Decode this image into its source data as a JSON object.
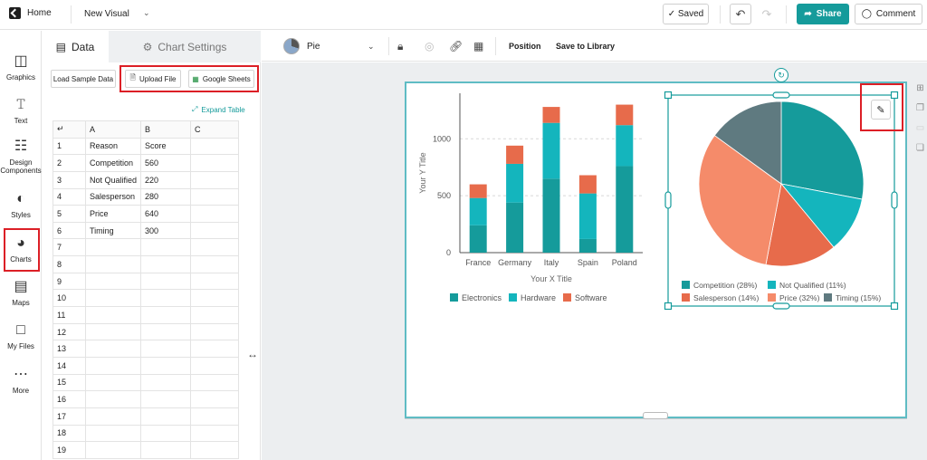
{
  "topbar": {
    "home_label": "Home",
    "project_name": "New Visual",
    "saved_label": "✓ Saved",
    "share_label": "Share",
    "comment_label": "Comment"
  },
  "sidebar": {
    "items": [
      {
        "label": "Graphics",
        "icon": "graphics-icon"
      },
      {
        "label": "Text",
        "icon": "text-icon"
      },
      {
        "label": "Design Components",
        "icon": "components-icon"
      },
      {
        "label": "Styles",
        "icon": "palette-icon"
      },
      {
        "label": "Charts",
        "icon": "chart-icon"
      },
      {
        "label": "Maps",
        "icon": "map-icon"
      },
      {
        "label": "My Files",
        "icon": "folder-icon"
      },
      {
        "label": "More",
        "icon": "grid-icon"
      }
    ]
  },
  "panel": {
    "tab_data": "Data",
    "tab_settings": "Chart Settings",
    "load_sample": "Load Sample Data",
    "upload_file": "Upload File",
    "google_sheets": "Google Sheets",
    "expand_table": "Expand Table",
    "columns": [
      "A",
      "B",
      "C"
    ],
    "rows": [
      [
        "Reason",
        "Score",
        ""
      ],
      [
        "Competition",
        "560",
        ""
      ],
      [
        "Not Qualified",
        "220",
        ""
      ],
      [
        "Salesperson",
        "280",
        ""
      ],
      [
        "Price",
        "640",
        ""
      ],
      [
        "Timing",
        "300",
        ""
      ],
      [
        "",
        "",
        ""
      ],
      [
        "",
        "",
        ""
      ],
      [
        "",
        "",
        ""
      ],
      [
        "",
        "",
        ""
      ],
      [
        "",
        "",
        ""
      ],
      [
        "",
        "",
        ""
      ],
      [
        "",
        "",
        ""
      ],
      [
        "",
        "",
        ""
      ],
      [
        "",
        "",
        ""
      ],
      [
        "",
        "",
        ""
      ],
      [
        "",
        "",
        ""
      ],
      [
        "",
        "",
        ""
      ],
      [
        "",
        "",
        ""
      ]
    ]
  },
  "chart_toolbar": {
    "chart_type": "Pie",
    "position_label": "Position",
    "save_library_label": "Save to Library"
  },
  "colors": {
    "teal_dark": "#159b9b",
    "teal_light": "#14b5bd",
    "orange": "#e76b4b",
    "salmon": "#f58b6a",
    "slate": "#5f7a80",
    "highlight_red": "#dc1f26"
  },
  "chart_data": [
    {
      "type": "bar",
      "stacked": true,
      "categories": [
        "France",
        "Germany",
        "Italy",
        "Spain",
        "Poland"
      ],
      "series": [
        {
          "name": "Electronics",
          "values": [
            240,
            440,
            650,
            120,
            760
          ],
          "color": "#159b9b"
        },
        {
          "name": "Hardware",
          "values": [
            240,
            340,
            490,
            400,
            360
          ],
          "color": "#14b5bd"
        },
        {
          "name": "Software",
          "values": [
            120,
            160,
            140,
            160,
            180
          ],
          "color": "#e76b4b"
        }
      ],
      "title": "",
      "xlabel": "Your X Title",
      "ylabel": "Your Y Title",
      "ylim": [
        0,
        1400
      ],
      "yticks": [
        0,
        500,
        1000
      ],
      "grid": true,
      "legend": "bottom"
    },
    {
      "type": "pie",
      "labels": [
        "Competition",
        "Not Qualified",
        "Salesperson",
        "Price",
        "Timing"
      ],
      "values": [
        560,
        220,
        280,
        640,
        300
      ],
      "legend_labels": [
        "Competition (28%)",
        "Not Qualified (11%)",
        "Salesperson (14%)",
        "Price (32%)",
        "Timing (15%)"
      ],
      "colors": [
        "#159b9b",
        "#14b5bd",
        "#e76b4b",
        "#f58b6a",
        "#5f7a80"
      ],
      "legend": "bottom"
    }
  ]
}
